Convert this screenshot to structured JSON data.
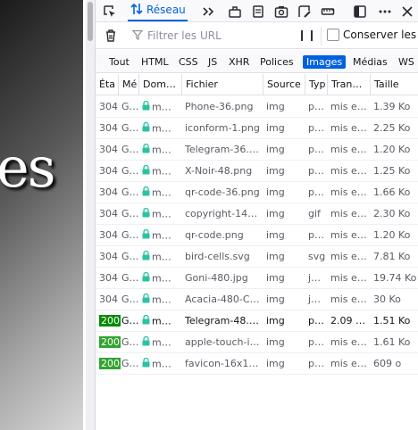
{
  "page": {
    "visible_text": "es"
  },
  "toolbar": {
    "network_tab": "Réseau"
  },
  "filter": {
    "placeholder": "Filtrer les URL",
    "persist_label": "Conserver les"
  },
  "type_filters": [
    "Tout",
    "HTML",
    "CSS",
    "JS",
    "XHR",
    "Polices",
    "Images",
    "Médias",
    "WS"
  ],
  "active_type_filter": "Images",
  "columns": [
    "Éta",
    "Mé",
    "Dom…",
    "Fichier",
    "Source",
    "Typ",
    "Tran…",
    "Taille"
  ],
  "requests": [
    {
      "status": "304",
      "method": "G…",
      "domain": "m…",
      "file": "Phone-36.png",
      "source": "img",
      "type": "p…",
      "transferred": "mis e…",
      "size": "1.39 Ko",
      "new": false
    },
    {
      "status": "304",
      "method": "G…",
      "domain": "m…",
      "file": "iconform-1.png",
      "source": "img",
      "type": "p…",
      "transferred": "mis e…",
      "size": "2.25 Ko",
      "new": false
    },
    {
      "status": "304",
      "method": "G…",
      "domain": "m…",
      "file": "Telegram-36.…",
      "source": "img",
      "type": "p…",
      "transferred": "mis e…",
      "size": "1.20 Ko",
      "new": false
    },
    {
      "status": "304",
      "method": "G…",
      "domain": "m…",
      "file": "X-Noir-48.png",
      "source": "img",
      "type": "p…",
      "transferred": "mis e…",
      "size": "1.25 Ko",
      "new": false
    },
    {
      "status": "304",
      "method": "G…",
      "domain": "m…",
      "file": "qr-code-36.png",
      "source": "img",
      "type": "p…",
      "transferred": "mis e…",
      "size": "1.66 Ko",
      "new": false
    },
    {
      "status": "304",
      "method": "G…",
      "domain": "m…",
      "file": "copyright-14…",
      "source": "img",
      "type": "gif",
      "transferred": "mis e…",
      "size": "2.30 Ko",
      "new": false
    },
    {
      "status": "304",
      "method": "G…",
      "domain": "m…",
      "file": "qr-code.png",
      "source": "img",
      "type": "p…",
      "transferred": "mis e…",
      "size": "1.20 Ko",
      "new": false
    },
    {
      "status": "304",
      "method": "G…",
      "domain": "m…",
      "file": "bird-cells.svg",
      "source": "img",
      "type": "svg",
      "transferred": "mis e…",
      "size": "7.81 Ko",
      "new": false
    },
    {
      "status": "304",
      "method": "G…",
      "domain": "m…",
      "file": "Goni-480.jpg",
      "source": "img",
      "type": "j…",
      "transferred": "mis e…",
      "size": "19.74 Ko",
      "new": false
    },
    {
      "status": "304",
      "method": "G…",
      "domain": "m…",
      "file": "Acacia-480-C…",
      "source": "img",
      "type": "j…",
      "transferred": "mis e…",
      "size": "30 Ko",
      "new": false
    },
    {
      "status": "200",
      "method": "G…",
      "domain": "m…",
      "file": "Telegram-48.…",
      "source": "img",
      "type": "p…",
      "transferred": "2.09 …",
      "size": "1.51 Ko",
      "new": true
    },
    {
      "status": "200",
      "method": "G…",
      "domain": "m…",
      "file": "apple-touch-i…",
      "source": "img",
      "type": "p…",
      "transferred": "mis e…",
      "size": "1.61 Ko",
      "new": false
    },
    {
      "status": "200",
      "method": "G…",
      "domain": "m…",
      "file": "favicon-16x1…",
      "source": "img",
      "type": "p…",
      "transferred": "mis e…",
      "size": "609 o",
      "new": false
    }
  ],
  "colors": {
    "accent": "#0061e0",
    "status_ok": "#058b00",
    "lock_green": "#2ac3a2"
  }
}
